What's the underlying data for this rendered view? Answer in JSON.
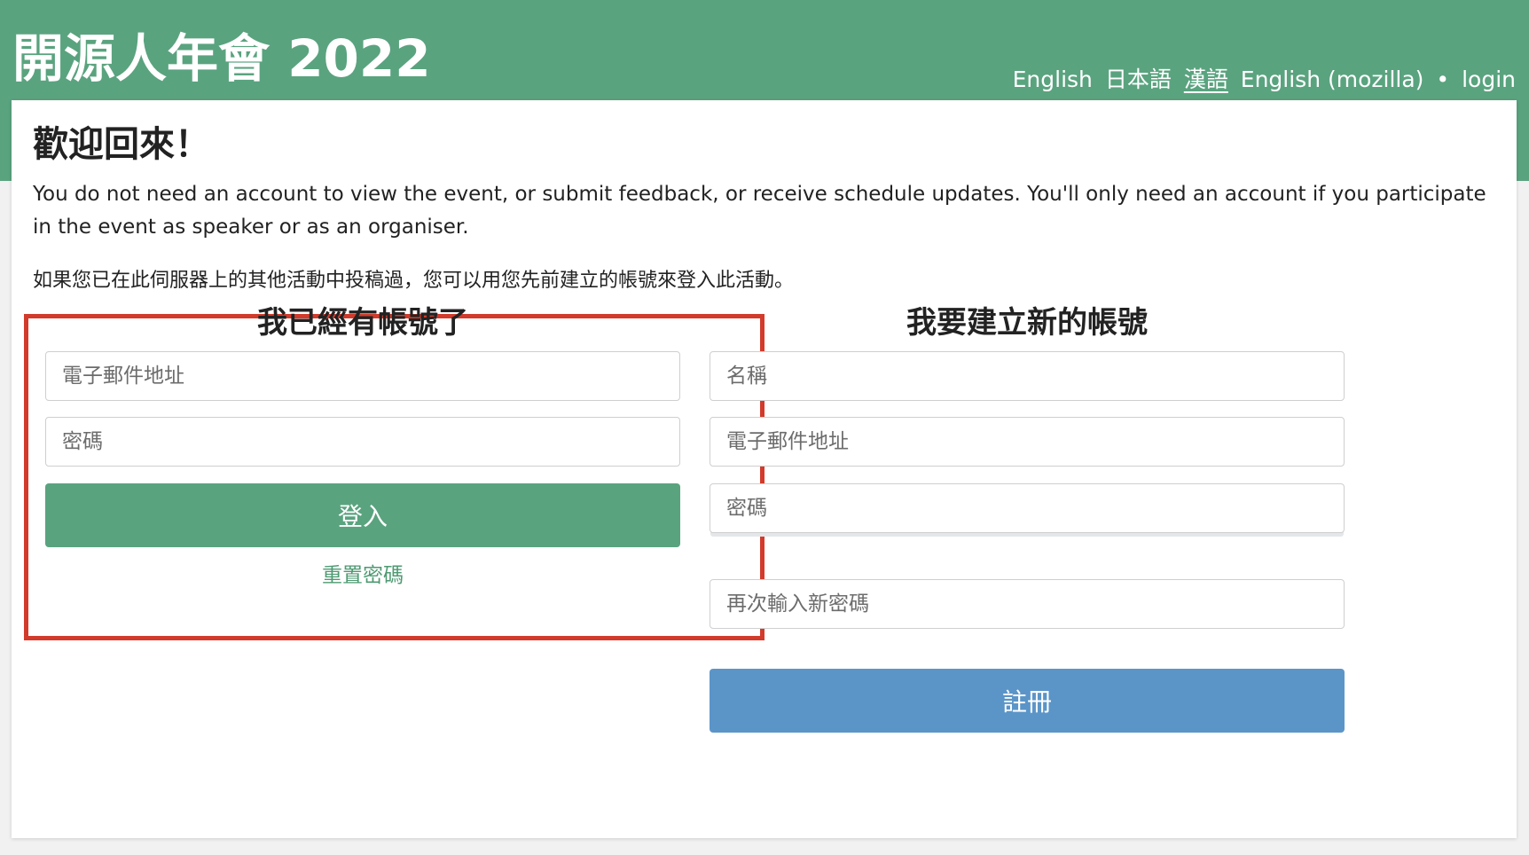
{
  "header": {
    "site_title": "開源人年會 2022",
    "languages": [
      {
        "label": "English"
      },
      {
        "label": "日本語"
      },
      {
        "label": "漢語"
      },
      {
        "label": "English (mozilla)"
      }
    ],
    "bullet": "•",
    "login_link": "login"
  },
  "main": {
    "welcome_title": "歡迎回來！",
    "intro_en": "You do not need an account to view the event, or submit feedback, or receive schedule updates. You'll only need an account if you participate in the event as speaker or as an organiser.",
    "intro_zh": "如果您已在此伺服器上的其他活動中投稿過，您可以用您先前建立的帳號來登入此活動。"
  },
  "login_form": {
    "title": "我已經有帳號了",
    "email_placeholder": "電子郵件地址",
    "password_placeholder": "密碼",
    "submit_label": "登入",
    "reset_password_label": "重置密碼"
  },
  "register_form": {
    "title": "我要建立新的帳號",
    "name_placeholder": "名稱",
    "email_placeholder": "電子郵件地址",
    "password_placeholder": "密碼",
    "password_repeat_placeholder": "再次輸入新密碼",
    "submit_label": "註冊"
  },
  "colors": {
    "brand_green": "#5aa37f",
    "register_blue": "#5b95c8",
    "highlight_red": "#d23b2b"
  }
}
